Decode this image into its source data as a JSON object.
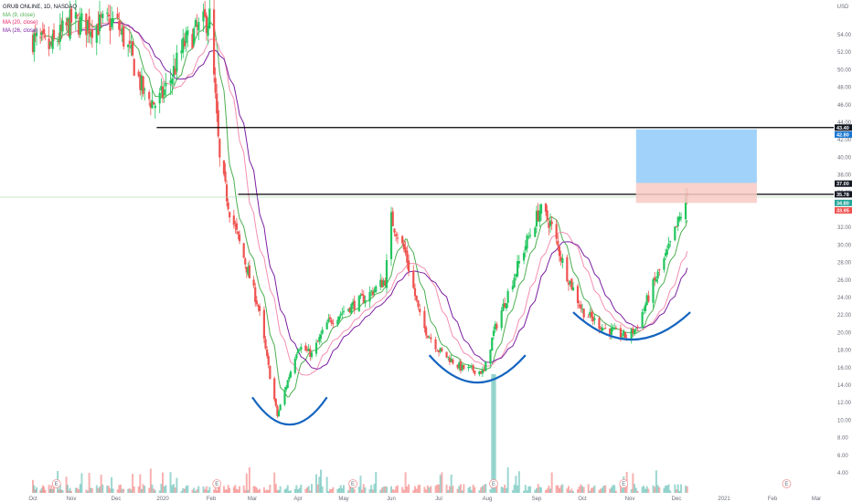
{
  "legend": {
    "symbol_line": "GRUB ONLINE, 1D, NASDAQ",
    "ma1": "MA (9, close)",
    "ma2": "MA (20, close)",
    "ma3": "MA (26, close)"
  },
  "axis": {
    "currency": "USD",
    "y_ticks": [
      "54.00",
      "52.00",
      "50.00",
      "48.00",
      "46.00",
      "44.00",
      "42.00",
      "40.00",
      "38.00",
      "36.00",
      "34.00",
      "32.00",
      "30.00",
      "28.00",
      "26.00",
      "24.00",
      "22.00",
      "20.00",
      "18.00",
      "16.00",
      "14.00",
      "12.00",
      "10.00",
      "8.00",
      "6.00",
      "4.00"
    ],
    "x_ticks": [
      "Oct",
      "Nov",
      "Dec",
      "2020",
      "Feb",
      "Mar",
      "Apr",
      "May",
      "Jun",
      "Jul",
      "Aug",
      "Sep",
      "Oct",
      "Nov",
      "Dec",
      "2021",
      "Feb",
      "Mar"
    ]
  },
  "price_badges": [
    "43.40",
    "42.80",
    "37.00",
    "35.78",
    "34.80",
    "33.95"
  ],
  "earnings_markers": [
    "E",
    "E",
    "E",
    "E",
    "E",
    "E"
  ],
  "colors": {
    "up": "#26a69a",
    "up_bright": "#21c55d",
    "down": "#ef5350",
    "ma1": "#4caf50",
    "ma2": "#f48fb1",
    "ma3": "#7b1fa2",
    "cup": "#1565c0",
    "target_zone": "#90caf9",
    "stop_zone": "#f8c9c4",
    "resistance": "#000000"
  },
  "chart_data": {
    "type": "candlestick",
    "series": [
      {
        "name": "GRUB ONLINE",
        "kind": "ohlc"
      },
      {
        "name": "MA (9, close)",
        "kind": "line"
      },
      {
        "name": "MA (20, close)",
        "kind": "line"
      },
      {
        "name": "MA (26, close)",
        "kind": "line"
      }
    ],
    "price_range": [
      3,
      56
    ],
    "close_path": [
      [
        "2019-10-01",
        53.5
      ],
      [
        "2019-10-15",
        52.5
      ],
      [
        "2019-11-01",
        55.5
      ],
      [
        "2019-11-15",
        55.0
      ],
      [
        "2019-12-01",
        55.5
      ],
      [
        "2019-12-10",
        52.0
      ],
      [
        "2019-12-20",
        47.0
      ],
      [
        "2019-12-28",
        46.0
      ],
      [
        "2020-01-05",
        48.5
      ],
      [
        "2020-01-15",
        53.0
      ],
      [
        "2020-01-31",
        56.0
      ],
      [
        "2020-02-07",
        39.5
      ],
      [
        "2020-02-14",
        34.0
      ],
      [
        "2020-02-25",
        28.0
      ],
      [
        "2020-03-05",
        23.0
      ],
      [
        "2020-03-12",
        16.0
      ],
      [
        "2020-03-18",
        10.5
      ],
      [
        "2020-03-25",
        14.5
      ],
      [
        "2020-04-01",
        18.5
      ],
      [
        "2020-04-10",
        17.5
      ],
      [
        "2020-04-20",
        21.0
      ],
      [
        "2020-05-01",
        22.5
      ],
      [
        "2020-05-15",
        24.0
      ],
      [
        "2020-05-28",
        26.0
      ],
      [
        "2020-06-01",
        33.0
      ],
      [
        "2020-06-10",
        29.0
      ],
      [
        "2020-06-20",
        21.0
      ],
      [
        "2020-07-01",
        18.0
      ],
      [
        "2020-07-15",
        16.0
      ],
      [
        "2020-07-30",
        15.5
      ],
      [
        "2020-08-05",
        20.0
      ],
      [
        "2020-08-15",
        25.0
      ],
      [
        "2020-08-25",
        30.0
      ],
      [
        "2020-09-03",
        34.0
      ],
      [
        "2020-09-10",
        32.5
      ],
      [
        "2020-09-20",
        27.0
      ],
      [
        "2020-10-01",
        22.5
      ],
      [
        "2020-10-15",
        20.5
      ],
      [
        "2020-10-30",
        19.5
      ],
      [
        "2020-11-05",
        20.5
      ],
      [
        "2020-11-15",
        25.0
      ],
      [
        "2020-11-25",
        29.0
      ],
      [
        "2020-12-03",
        33.0
      ],
      [
        "2020-12-08",
        35.5
      ]
    ],
    "volume_spike": {
      "date": "2020-08-05",
      "note": "largest bar"
    },
    "resistance_levels": [
      43.4,
      35.78
    ],
    "position": {
      "entry": 35.78,
      "target": 43.2,
      "stop": 34.8,
      "label_stop": 33.95
    },
    "cup_patterns": [
      {
        "start": "2020-03-01",
        "end": "2020-04-20",
        "low": 9.5
      },
      {
        "start": "2020-06-25",
        "end": "2020-08-25",
        "low": 14.3
      },
      {
        "start": "2020-09-25",
        "end": "2020-12-10",
        "low": 19.2
      }
    ],
    "grid": false,
    "legend_position": "top-left"
  }
}
